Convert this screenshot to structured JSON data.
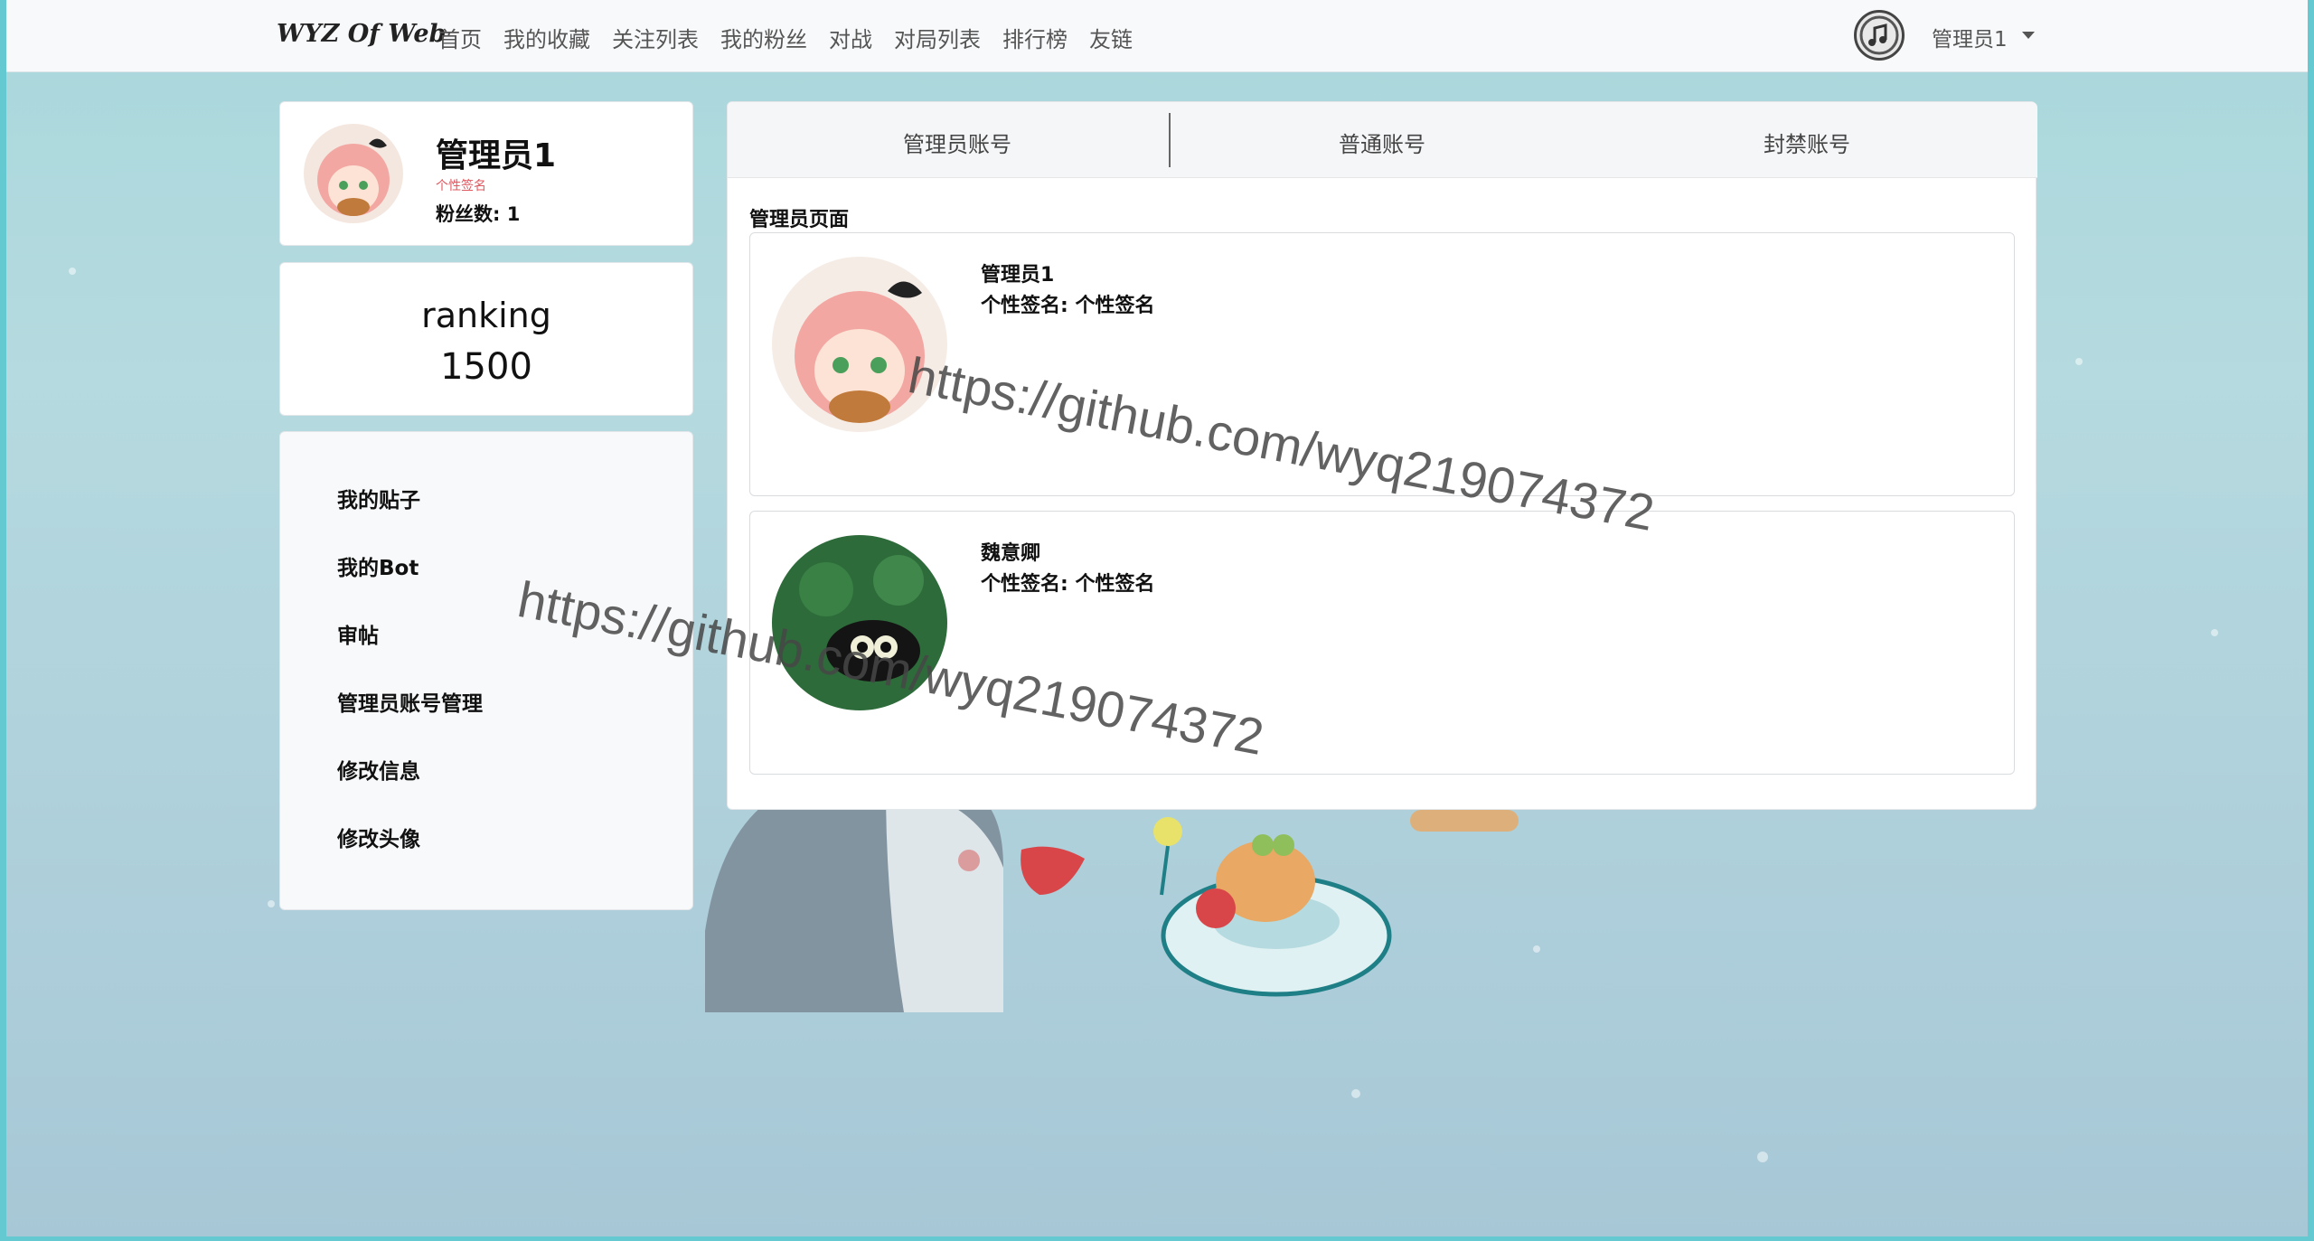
{
  "nav": {
    "brand": "WYZ Of Web",
    "items": [
      {
        "label": "首页"
      },
      {
        "label": "我的收藏"
      },
      {
        "label": "关注列表"
      },
      {
        "label": "我的粉丝"
      },
      {
        "label": "对战"
      },
      {
        "label": "对局列表"
      },
      {
        "label": "排行榜"
      },
      {
        "label": "友链"
      }
    ],
    "user_label": "管理员1"
  },
  "profile": {
    "name": "管理员1",
    "signature": "个性签名",
    "fans": "粉丝数: 1"
  },
  "ranking": {
    "title": "ranking",
    "value": "1500"
  },
  "sidebar": {
    "items": [
      {
        "label": "我的贴子"
      },
      {
        "label": "我的Bot"
      },
      {
        "label": "审帖"
      },
      {
        "label": "管理员账号管理"
      },
      {
        "label": "修改信息"
      },
      {
        "label": "修改头像"
      }
    ]
  },
  "main": {
    "tabs": [
      {
        "label": "管理员账号"
      },
      {
        "label": "普通账号"
      },
      {
        "label": "封禁账号"
      }
    ],
    "section_title": "管理员页面",
    "users": [
      {
        "name": "管理员1",
        "signature": "个性签名: 个性签名"
      },
      {
        "name": "魏意卿",
        "signature": "个性签名: 个性签名"
      }
    ]
  },
  "watermarks": [
    "https://github.com/wyq219074372",
    "https://github.com/wyq219074372"
  ],
  "colors": {
    "navbar_bg": "#f8f9fa",
    "signature_red": "#e0575f",
    "background_teal": "#a9d8dc"
  }
}
